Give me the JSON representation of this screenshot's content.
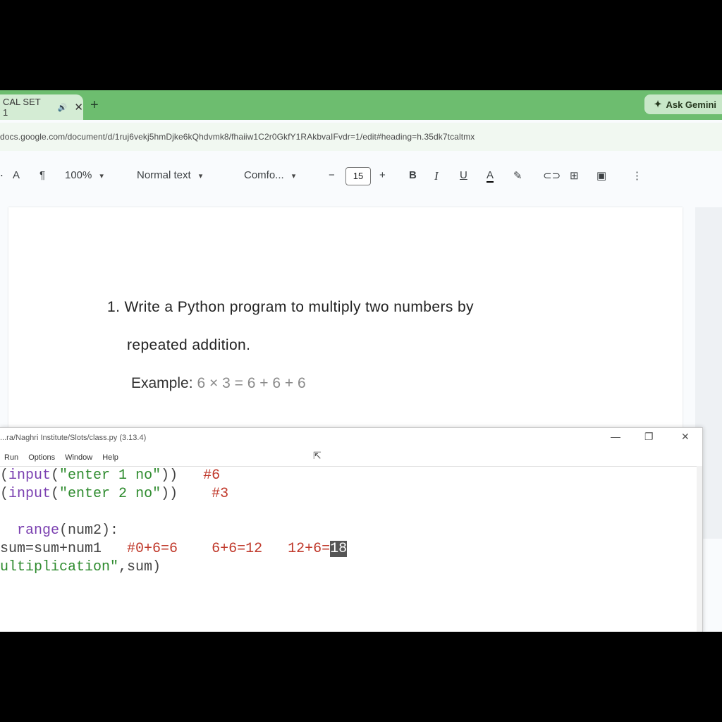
{
  "browser": {
    "tab": {
      "title": "CAL SET 1",
      "audio_icon": "🔊",
      "close": "✕"
    },
    "new_tab": "+",
    "ask_gemini": "Ask Gemini",
    "url": "docs.google.com/document/d/1ruj6vekj5hmDjke6kQhdvmk8/fhaiiw1C2r0GkfY1RAkbvaIFvdr=1/edit#heading=h.35dk7tcaltmx"
  },
  "toolbar": {
    "zoom": "100%",
    "style": "Normal text",
    "font": "Comfo...",
    "font_size": "15",
    "bold": "B",
    "italic": "I",
    "underline": "U",
    "text_color": "A"
  },
  "doc": {
    "question_line1": "1. Write a Python program to multiply two numbers by",
    "question_line2": "repeated addition.",
    "example_label": "Example:",
    "example_value": "6 × 3 = 6 + 6 + 6"
  },
  "idle": {
    "title": "...ra/Naghri Institute/Slots/class.py (3.13.4)",
    "menu": [
      "Run",
      "Options",
      "Window",
      "Help"
    ],
    "code": {
      "line1": {
        "open": "(",
        "call": "input",
        "str": "\"enter 1 no\"",
        "close": "))",
        "comment": "#6"
      },
      "line2": {
        "open": "(",
        "call": "input",
        "str": "\"enter 2 no\"",
        "close": "))",
        "comment": "#3"
      },
      "line4": {
        "kw": "range",
        "rest": "(num2):"
      },
      "line5": {
        "code": "sum=sum+num1",
        "c1": "#0+6=6",
        "c2": "6+6=12",
        "c3": "12+6=",
        "cursor": "18"
      },
      "line6": {
        "str": "ultiplication\"",
        "rest": ",sum)"
      }
    }
  }
}
